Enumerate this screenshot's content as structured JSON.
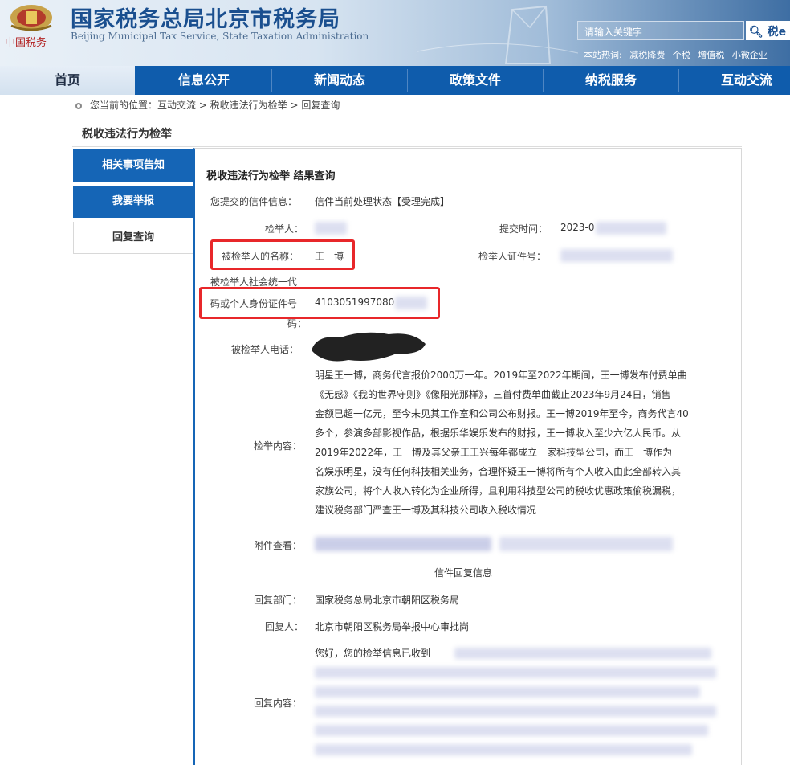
{
  "header": {
    "title": "国家税务总局北京市税务局",
    "title_en": "Beijing Municipal Tax Service, State Taxation Administration",
    "brand_sub": "中国税务",
    "search_placeholder": "请输入关键字",
    "search_button": "税e",
    "hot_label": "本站热词:",
    "hot_words": [
      "减税降费",
      "个税",
      "增值税",
      "小微企业"
    ]
  },
  "nav": {
    "items": [
      "首页",
      "信息公开",
      "新闻动态",
      "政策文件",
      "纳税服务",
      "互动交流"
    ]
  },
  "breadcrumb": {
    "text": "您当前的位置：互动交流 > 税收违法行为检举 > 回复查询"
  },
  "section": {
    "title": "税收违法行为检举"
  },
  "sidebar": {
    "items": [
      "相关事项告知",
      "我要举报",
      "回复查询"
    ]
  },
  "content": {
    "title": "税收违法行为检举 结果查询",
    "status_label": "您提交的信件信息：",
    "status_value": "信件当前处理状态【受理完成】",
    "reporter_label": "检举人：",
    "submit_time_label": "提交时间：",
    "submit_time_value": "2023-0",
    "name_label": "被检举人的名称：",
    "name_value": "王一博",
    "reporter_id_label": "检举人证件号：",
    "code_label_1": "被检举人社会统一代",
    "code_label_2": "码或个人身份证件号",
    "code_label_3": "码：",
    "code_value": "4103051997080",
    "phone_label": "被检举人电话：",
    "report_label": "检举内容：",
    "report_lines": [
      "明星王一博，商务代言报价2000万一年。2019年至2022年期间，王一博发布付费单曲",
      "《无感》《我的世界守则》《像阳光那样》，三首付费单曲截止2023年9月24日，销售",
      "金额已超一亿元，至今未见其工作室和公司公布财报。王一博2019年至今，商务代言40",
      "多个，参演多部影视作品，根据乐华娱乐发布的财报，王一博收入至少六亿人民币。从",
      "2019年2022年，王一博及其父亲王王兴每年都成立一家科技型公司，而王一博作为一",
      "名娱乐明星，没有任何科技相关业务，合理怀疑王一博将所有个人收入由此全部转入其",
      "家族公司，将个人收入转化为企业所得，且利用科技型公司的税收优惠政策偷税漏税，",
      "建议税务部门严查王一博及其科技公司收入税收情况"
    ],
    "attachment_label": "附件查看：",
    "reply_header": "信件回复信息",
    "dept_label": "回复部门：",
    "dept_value": "国家税务总局北京市朝阳区税务局",
    "replier_label": "回复人：",
    "replier_value": "北京市朝阳区税务局举报中心审批岗",
    "reply_label": "回复内容：",
    "reply_start": "您好，您的检举信息已收到"
  },
  "colors": {
    "nav_blue": "#0f5cac",
    "highlight_red": "#e8272a",
    "title_blue": "#1a4f8f"
  }
}
